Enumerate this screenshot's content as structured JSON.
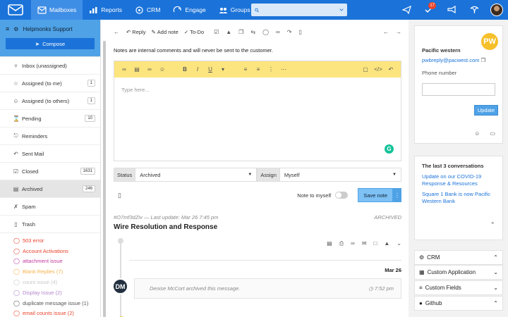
{
  "nav": {
    "items": [
      {
        "label": "Mailboxes",
        "icon": "envelope-icon"
      },
      {
        "label": "Reports",
        "icon": "bar-chart-icon"
      },
      {
        "label": "CRM",
        "icon": "crm-icon"
      },
      {
        "label": "Engage",
        "icon": "engage-icon"
      },
      {
        "label": "Groups",
        "icon": "groups-icon"
      }
    ],
    "search_value": "",
    "notification_count": "17"
  },
  "sidebar": {
    "mailbox_name": "Helpmonks Support",
    "compose_label": "Compose",
    "folders": [
      {
        "label": "Inbox (unassigned)",
        "icon": "inbox-icon",
        "count": ""
      },
      {
        "label": "Assigned (to me)",
        "icon": "star-icon",
        "count": "1"
      },
      {
        "label": "Assigned (to others)",
        "icon": "users-icon",
        "count": "1"
      },
      {
        "label": "Pending",
        "icon": "hourglass-icon",
        "count": "10"
      },
      {
        "label": "Reminders",
        "icon": "bell-icon",
        "count": ""
      },
      {
        "label": "Sent Mail",
        "icon": "reply-icon",
        "count": ""
      },
      {
        "label": "Closed",
        "icon": "checkbox-icon",
        "count": "1631"
      },
      {
        "label": "Archived",
        "icon": "archive-icon",
        "count": "246"
      },
      {
        "label": "Spam",
        "icon": "spam-icon",
        "count": ""
      },
      {
        "label": "Trash",
        "icon": "trash-icon",
        "count": ""
      }
    ],
    "tags": [
      {
        "label": "503 error",
        "color": "#e8432b"
      },
      {
        "label": "Account Activations",
        "color": "#e8432b"
      },
      {
        "label": "attachment issue",
        "color": "#c0399f"
      },
      {
        "label": "Blank Replies (7)",
        "color": "#f5b24a"
      },
      {
        "label": "count issue (4)",
        "color": "#c8c8c8"
      },
      {
        "label": "Display Issue (2)",
        "color": "#b084cc"
      },
      {
        "label": "duplicate message issue (1)",
        "color": "#555555"
      },
      {
        "label": "email counts issue (2)",
        "color": "#e8432b"
      }
    ]
  },
  "toolbar": {
    "reply_label": "Reply",
    "add_note_label": "Add note",
    "todo_label": "To-Do"
  },
  "main": {
    "note_info": "Notes are internal comments and will never be sent to the customer.",
    "editor_placeholder": "Type here...",
    "status_label": "Status",
    "status_value": "Archived",
    "assign_label": "Assign",
    "assign_value": "Myself",
    "note_to_myself_label": "Note to myself",
    "save_note_label": "Save note",
    "conversation_id": "#O7mf3dZiv",
    "last_update": "— Last update: Mar 26 7:45 pm",
    "conversation_state": "ARCHIVED",
    "conversation_title": "Wire Resolution and Response",
    "date_label": "Mar 26",
    "agent_initials": "DM",
    "system_message": "Denise McCort archived this message.",
    "system_time": "7:52 pm"
  },
  "contact": {
    "initials": "PW",
    "company": "Pacific western",
    "email": "pwbreply@pacwest.com",
    "phone_label": "Phone number",
    "phone_value": "",
    "update_label": "Update"
  },
  "conversations": {
    "title": "The last 3 conversations",
    "items": [
      "Update on our COVID-19 Response & Resources",
      "Square 1 Bank is now Pacific Western Bank"
    ]
  },
  "panels": [
    "CRM",
    "Custom Application",
    "Custom Fields",
    "Github"
  ],
  "colors": {
    "brand": "#1b73d9",
    "editor_toolbar": "#fce57e",
    "avatar_pw": "#f6c02b"
  }
}
